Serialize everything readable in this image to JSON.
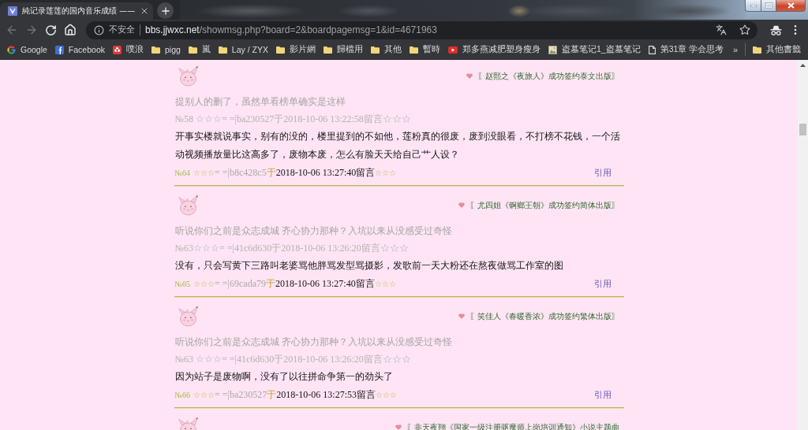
{
  "browser": {
    "tabs": [
      {
        "title": "純记录莲莲的国内音乐成绩 ——",
        "selected": true
      }
    ],
    "address_bar": {
      "security": "不安全",
      "host": "bbs.jjwxc.net",
      "path": "/showmsg.php?board=2&boardpagemsg=1&id=4671963"
    },
    "bookmarks": [
      {
        "label": "Google",
        "kind": "g-logo"
      },
      {
        "label": "Facebook",
        "kind": "f-logo"
      },
      {
        "label": "噗浪",
        "kind": "flower-logo"
      },
      {
        "label": "pigg",
        "kind": "folder"
      },
      {
        "label": "嵐",
        "kind": "folder"
      },
      {
        "label": "Lay / ZYX",
        "kind": "folder"
      },
      {
        "label": "影片網",
        "kind": "folder"
      },
      {
        "label": "歸檔用",
        "kind": "folder"
      },
      {
        "label": "其他",
        "kind": "folder"
      },
      {
        "label": "暫時",
        "kind": "folder"
      },
      {
        "label": "郑多燕减肥塑身瘦身",
        "kind": "video"
      },
      {
        "label": "盗墓笔记1_盗墓笔记",
        "kind": "picture"
      },
      {
        "label": "第31章 学会思考",
        "kind": "page"
      }
    ],
    "bookmarks_overflow": "»",
    "other_bookmarks": {
      "label": "其他書籤",
      "kind": "folder"
    }
  },
  "posts": [
    {
      "tag": "〖赵熙之《夜旅人》成功签约泰文出版〗",
      "quote": "提别人的删了，虽然单看榜单确实是这样",
      "quote_meta": "№58 ☆☆☆= =|ba230527于2018-10-06 13:22:58留言☆☆☆",
      "body": "开事实楼就说事实，别有的没的，楼里提到的不如他，莲粉真的很废，废到没眼看，不打榜不花钱，一个活动视频播放量比这高多了，废物本废，怎么有脸天天给自己艹人设？",
      "footer": {
        "floor": "№64",
        "stars": "☆☆☆",
        "user": "= =|b8c428c5",
        "at": "于",
        "time": "2018-10-06 13:27:40留言",
        "stars_after": "☆☆☆"
      },
      "quote_link": "引用"
    },
    {
      "tag": "〖尤四姐《锕鄉王朝》成功签约简体出版〗",
      "quote": "听说你们之前是众志成城 齐心协力那种？入坑以来从没感受过奇怪",
      "quote_meta": "№63☆☆☆= =|41c6d630于2018-10-06 13:26:20留言☆☆☆",
      "body": "没有，只会写黄下三路叫老婆骂他胖骂发型骂摄影，发歌前一天大粉还在熬夜做骂工作室的图",
      "footer": {
        "floor": "№65",
        "stars": "☆☆☆",
        "user": "= =|69cada79",
        "at": "于",
        "time": "2018-10-06 13:27:40留言",
        "stars_after": "☆☆☆"
      },
      "quote_link": "引用"
    },
    {
      "tag": "〖笑佳人《春暖香浓》成功签约繁体出版〗",
      "quote": "听说你们之前是众志成城 齐心协力那种？入坑以来从没感受过奇怪",
      "quote_meta": "№63 ☆☆☆= =|41c6d630于2018-10-06 13:26:20留言☆☆☆",
      "body": "因为站子是废物啊，没有了以往拼命争第一的劲头了",
      "footer": {
        "floor": "№66",
        "stars": "☆☆☆",
        "user": "= =|ba230527",
        "at": "于",
        "time": "2018-10-06 13:27:53留言",
        "stars_after": "☆☆☆"
      },
      "quote_link": "引用"
    },
    {
      "tag": "〖非天夜翔《国家一级注册驱魔师上岗培训通知》小说主题曲"
    }
  ]
}
